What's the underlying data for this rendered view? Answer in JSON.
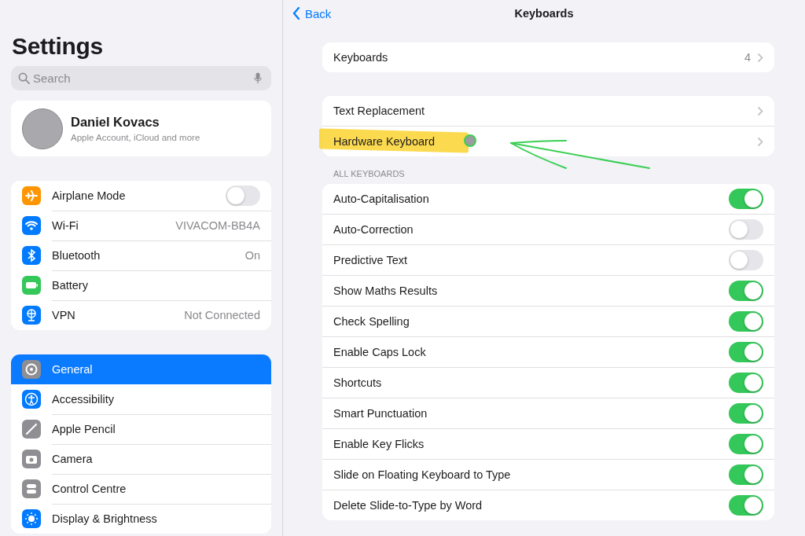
{
  "sidebar": {
    "title": "Settings",
    "search": {
      "placeholder": "Search"
    },
    "profile": {
      "name": "Daniel Kovacs",
      "subtitle": "Apple Account, iCloud and more"
    },
    "groups": [
      [
        {
          "kind": "toggle",
          "label": "Airplane Mode",
          "on": false,
          "selected": false
        },
        {
          "kind": "value",
          "label": "Wi-Fi",
          "value": "VIVACOM-BB4A",
          "selected": false
        },
        {
          "kind": "value",
          "label": "Bluetooth",
          "value": "On",
          "selected": false
        },
        {
          "kind": "link",
          "label": "Battery",
          "selected": false
        },
        {
          "kind": "value",
          "label": "VPN",
          "value": "Not Connected",
          "selected": false
        }
      ],
      [
        {
          "kind": "link",
          "label": "General",
          "selected": true
        },
        {
          "kind": "link",
          "label": "Accessibility",
          "selected": false
        },
        {
          "kind": "link",
          "label": "Apple Pencil",
          "selected": false
        },
        {
          "kind": "link",
          "label": "Camera",
          "selected": false
        },
        {
          "kind": "link",
          "label": "Control Centre",
          "selected": false
        },
        {
          "kind": "link",
          "label": "Display & Brightness",
          "selected": false
        }
      ]
    ]
  },
  "detail": {
    "back": "Back",
    "title": "Keyboards",
    "groups": [
      {
        "rows": [
          {
            "kind": "link",
            "label": "Keyboards",
            "value": "4",
            "highlighted": false
          }
        ]
      },
      {
        "rows": [
          {
            "kind": "link",
            "label": "Text Replacement",
            "highlighted": false
          },
          {
            "kind": "link",
            "label": "Hardware Keyboard",
            "highlighted": true
          }
        ]
      },
      {
        "header": "ALL KEYBOARDS",
        "rows": [
          {
            "kind": "toggle",
            "label": "Auto-Capitalisation",
            "on": true
          },
          {
            "kind": "toggle",
            "label": "Auto-Correction",
            "on": false
          },
          {
            "kind": "toggle",
            "label": "Predictive Text",
            "on": false
          },
          {
            "kind": "toggle",
            "label": "Show Maths Results",
            "on": true
          },
          {
            "kind": "toggle",
            "label": "Check Spelling",
            "on": true
          },
          {
            "kind": "toggle",
            "label": "Enable Caps Lock",
            "on": true
          },
          {
            "kind": "toggle",
            "label": "Shortcuts",
            "on": true
          },
          {
            "kind": "toggle",
            "label": "Smart Punctuation",
            "on": true
          },
          {
            "kind": "toggle",
            "label": "Enable Key Flicks",
            "on": true
          },
          {
            "kind": "toggle",
            "label": "Slide on Floating Keyboard to Type",
            "on": true
          },
          {
            "kind": "toggle",
            "label": "Delete Slide-to-Type by Word",
            "on": true
          }
        ]
      }
    ]
  }
}
